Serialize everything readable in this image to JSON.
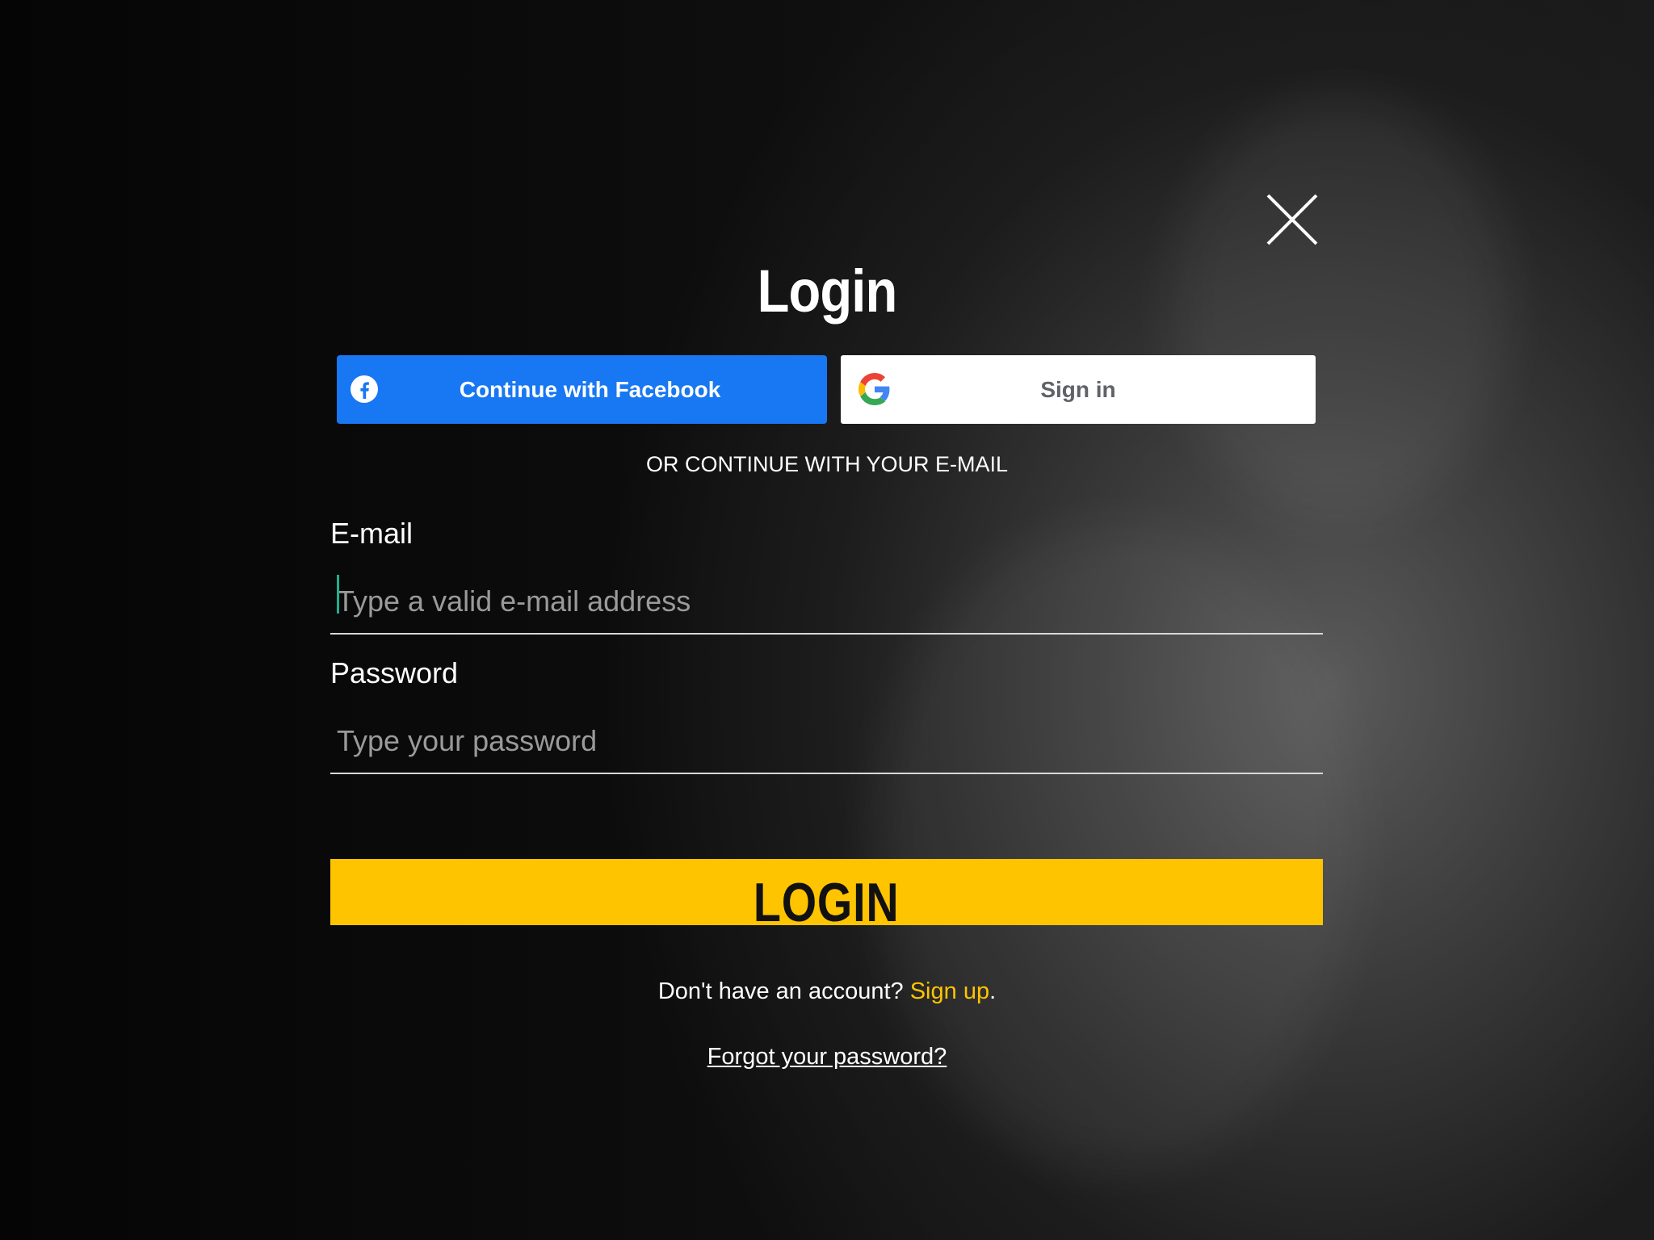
{
  "dialog": {
    "title": "Login",
    "close_icon": "close-icon"
  },
  "social": {
    "facebook": {
      "label": "Continue with Facebook",
      "icon": "facebook-icon",
      "color": "#1877f2"
    },
    "google": {
      "label": "Sign in",
      "icon": "google-icon"
    }
  },
  "divider": {
    "text": "OR CONTINUE WITH YOUR E-MAIL"
  },
  "form": {
    "email": {
      "label": "E-mail",
      "placeholder": "Type a valid e-mail address",
      "value": ""
    },
    "password": {
      "label": "Password",
      "placeholder": "Type your password",
      "value": ""
    },
    "submit_label": "LOGIN",
    "accent_color": "#ffc400"
  },
  "footer": {
    "no_account_text": "Don't have an account?",
    "signup_link": "Sign up",
    "signup_suffix": ".",
    "forgot_password": "Forgot your password?"
  }
}
